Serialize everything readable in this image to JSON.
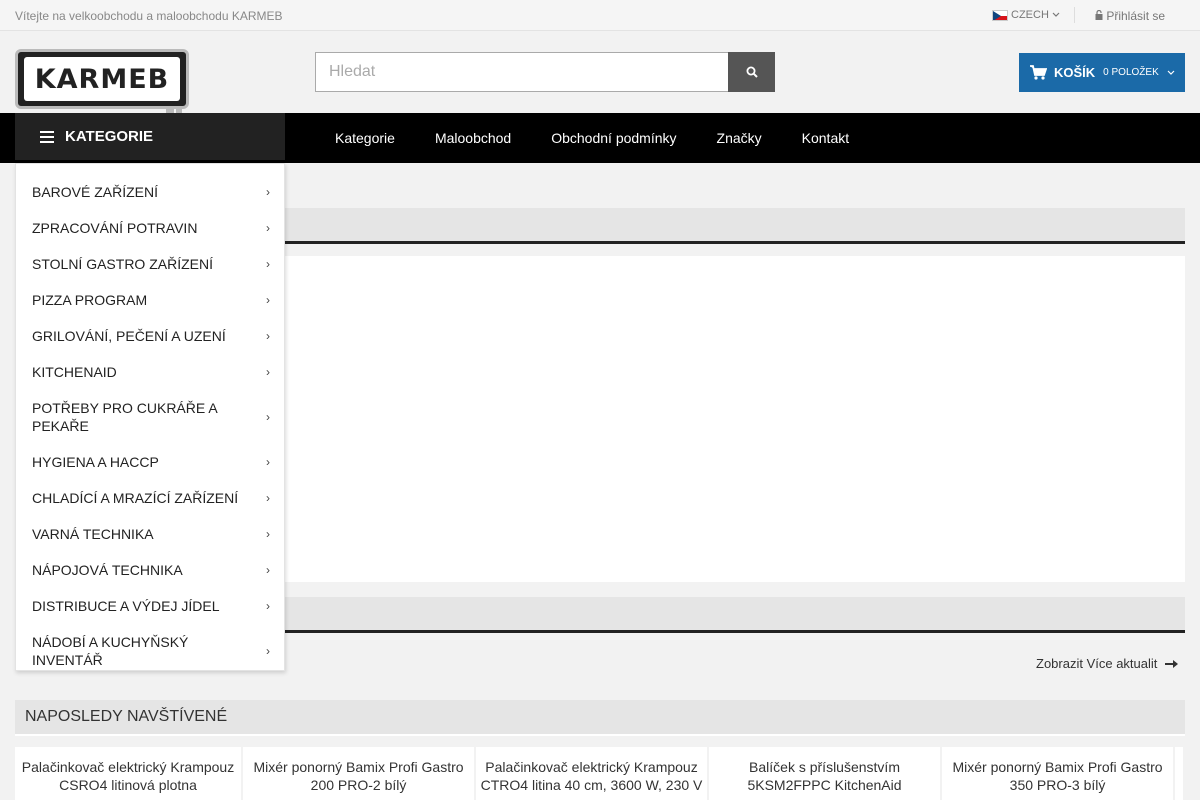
{
  "topbar": {
    "welcome": "Vítejte na velkoobchodu a maloobchodu KARMEB",
    "language": "CZECH",
    "login": "Přihlásit se"
  },
  "header": {
    "logo_text": "KARMEB",
    "search_placeholder": "Hledat",
    "cart_label": "KOŠÍK",
    "cart_count": "0 POLOŽEK"
  },
  "nav": {
    "categories_label": "KATEGORIE",
    "links": [
      "Kategorie",
      "Maloobchod",
      "Obchodní podmínky",
      "Značky",
      "Kontakt"
    ]
  },
  "category_menu": [
    "BAROVÉ ZAŘÍZENÍ",
    "ZPRACOVÁNÍ POTRAVIN",
    "STOLNÍ GASTRO ZAŘÍZENÍ",
    "PIZZA PROGRAM",
    "GRILOVÁNÍ, PEČENÍ A UZENÍ",
    "KITCHENAID",
    "POTŘEBY PRO CUKRÁŘE A PEKAŘE",
    "HYGIENA A HACCP",
    "CHLADÍCÍ A MRAZÍCÍ ZAŘÍZENÍ",
    "VARNÁ TECHNIKA",
    "NÁPOJOVÁ TECHNIKA",
    "DISTRIBUCE A VÝDEJ JÍDEL",
    "NÁDOBÍ A KUCHYŇSKÝ INVENTÁŘ"
  ],
  "news": {
    "more_link": "Zobrazit Více aktualit"
  },
  "recent": {
    "title": "NAPOSLEDY NAVŠTÍVENÉ",
    "items": [
      "Palačinkovač elektrický Krampouz CSRO4 litinová plotna",
      "Mixér ponorný Bamix Profi Gastro 200 PRO-2 bílý",
      "Palačinkovač elektrický Krampouz CTRO4 litina 40 cm, 3600 W, 230 V",
      "Balíček s příslušenstvím 5KSM2FPPC KitchenAid",
      "Mixér ponorný Bamix Profi Gastro 350 PRO-3 bílý"
    ]
  },
  "colors": {
    "accent": "#1b6aa8",
    "nav_bg": "#000000"
  }
}
